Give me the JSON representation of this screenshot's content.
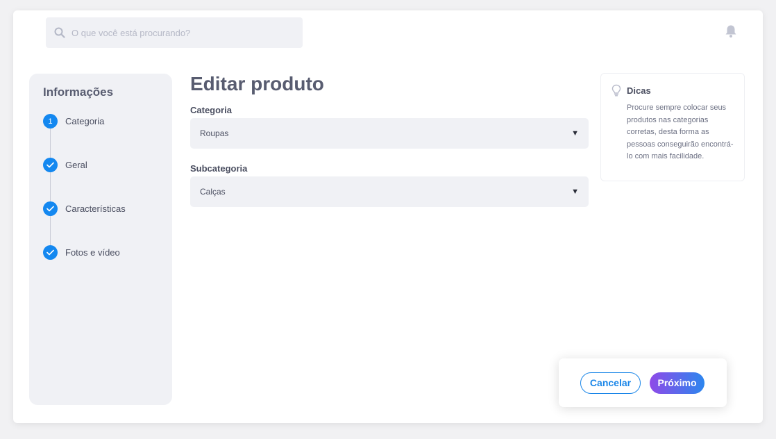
{
  "header": {
    "search": {
      "placeholder": "O que você está procurando?",
      "value": "",
      "icon": "search-icon"
    },
    "notification_icon": "bell-icon"
  },
  "sidebar": {
    "title": "Informações",
    "steps": [
      {
        "label": "Categoria",
        "marker": "1",
        "state": "current"
      },
      {
        "label": "Geral",
        "marker": "check",
        "state": "done"
      },
      {
        "label": "Características",
        "marker": "check",
        "state": "done"
      },
      {
        "label": "Fotos e vídeo",
        "marker": "check",
        "state": "done"
      }
    ]
  },
  "main": {
    "title": "Editar produto",
    "fields": [
      {
        "label": "Categoria",
        "value": "Roupas"
      },
      {
        "label": "Subcategoria",
        "value": "Calças"
      }
    ]
  },
  "tips": {
    "icon": "lightbulb-icon",
    "title": "Dicas",
    "body": "Procure sempre colocar seus produtos nas categorias corretas, desta forma as pessoas conseguirão encontrá-lo com mais facilidade."
  },
  "actions": {
    "cancel_label": "Cancelar",
    "next_label": "Próximo"
  },
  "colors": {
    "accent": "#1488f0",
    "gradient_start": "#8f4ae8",
    "gradient_end": "#2c86ee",
    "panel_bg": "#f0f1f5"
  }
}
